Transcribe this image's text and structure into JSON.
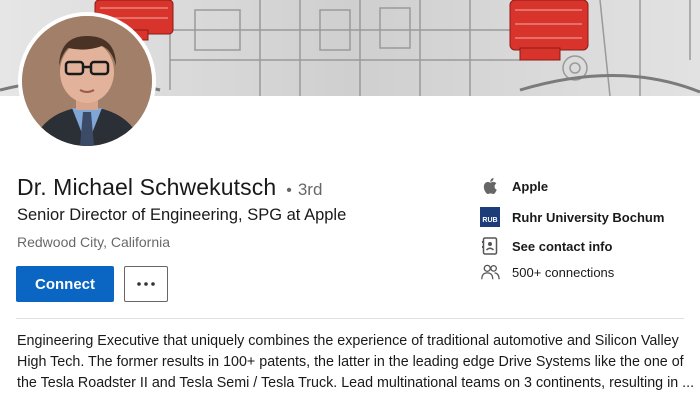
{
  "profile": {
    "name": "Dr. Michael Schwekutsch",
    "degree_separator": "•",
    "degree": "3rd",
    "headline": "Senior Director of Engineering, SPG at Apple",
    "location": "Redwood City, California"
  },
  "actions": {
    "connect_label": "Connect",
    "more_label": "..."
  },
  "sidebar": {
    "company": {
      "label": "Apple",
      "icon": "apple-logo-icon"
    },
    "school": {
      "label": "Ruhr University Bochum",
      "icon": "rub-logo-icon",
      "logo_text": "RUB"
    },
    "contact": {
      "label": "See contact info",
      "icon": "contact-card-icon"
    },
    "connections": {
      "label": "500+ connections",
      "icon": "people-icon"
    }
  },
  "about": {
    "lines": [
      "Engineering Executive that uniquely combines the experience of traditional automotive and Silicon Valley",
      "High Tech. The former results in 100+ patents, the latter in the leading edge Drive Systems like the one of",
      "the Tesla Roadster II and Tesla Semi / Tesla Truck. Lead multinational teams on 3 continents, resulting in ..."
    ]
  },
  "colors": {
    "primary": "#0a66c2",
    "text": "#191919",
    "muted": "#666666",
    "banner_accent": "#d32f2f",
    "school_logo": "#1c3d7a"
  }
}
